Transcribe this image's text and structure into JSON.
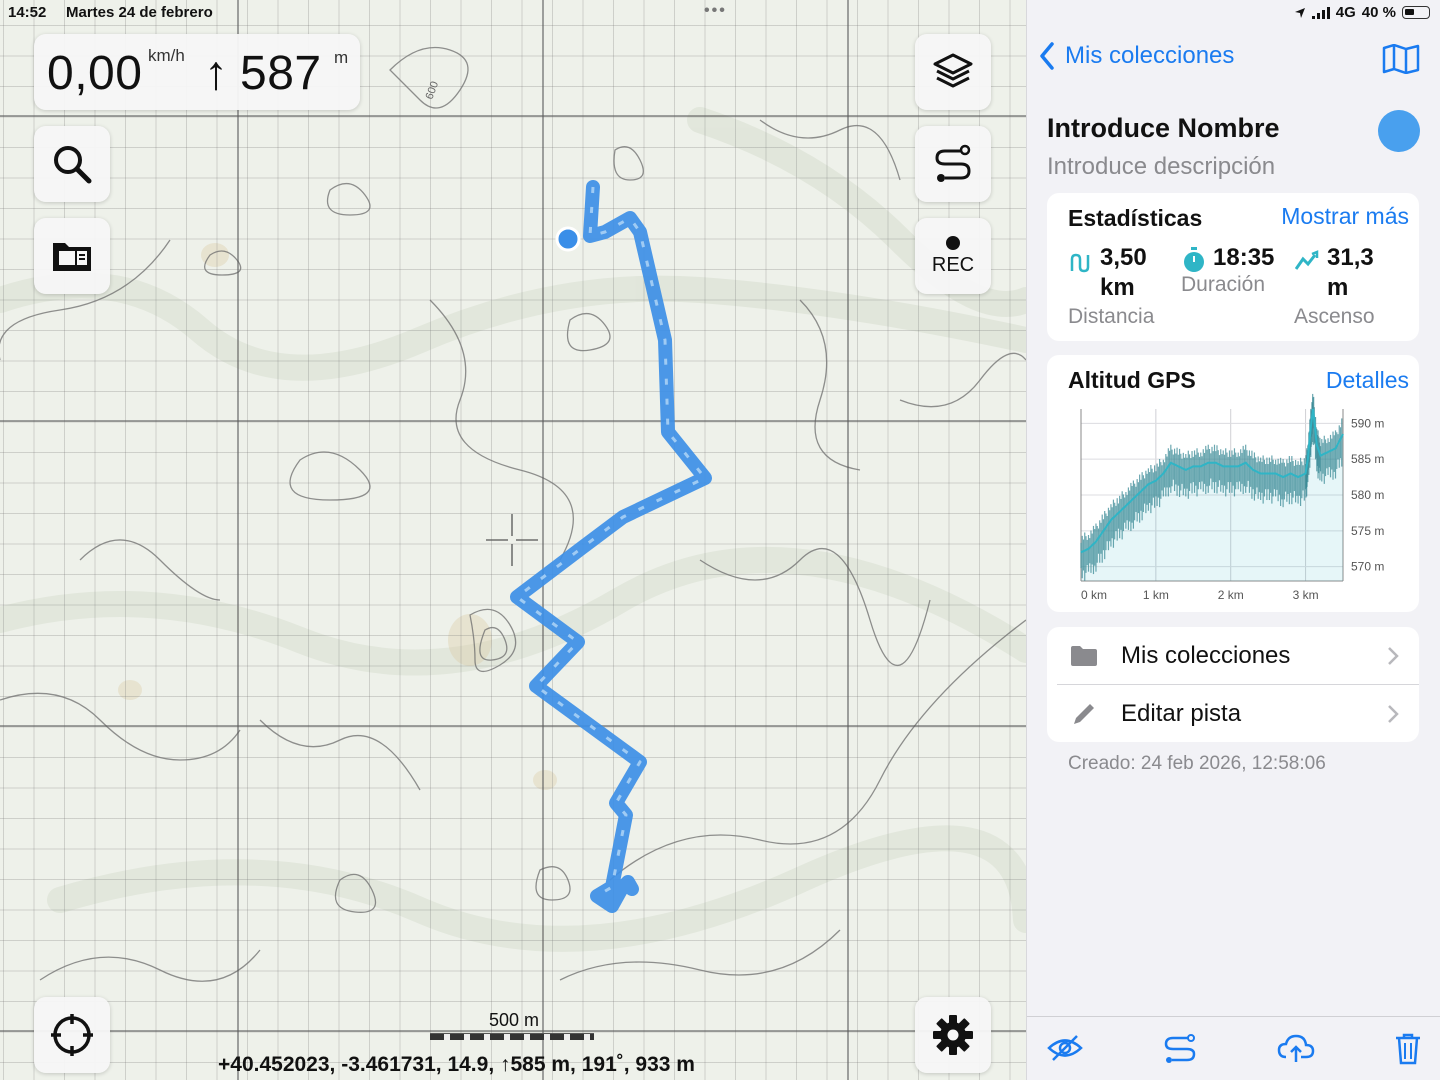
{
  "status": {
    "time": "14:52",
    "date": "Martes 24 de febrero",
    "network": "4G",
    "battery": "40 %"
  },
  "speed_panel": {
    "speed": "0,00",
    "speed_unit": "km/h",
    "altitude": "587",
    "altitude_unit": "m",
    "altitude_arrow": "↑"
  },
  "map_buttons": {
    "search": "search-icon",
    "collections": "folder-map-icon",
    "layers": "layers-icon",
    "route": "route-icon",
    "rec": "REC",
    "locate": "locate-icon",
    "settings": "gear-icon"
  },
  "map": {
    "contour_label": "600",
    "scale_label": "500 m",
    "coords": "+40.452023, -3.461731, 14.9, ↑585 m, 191˚, 933 m"
  },
  "panel": {
    "back_label": "Mis colecciones",
    "title": "Introduce Nombre",
    "description": "Introduce descripción",
    "track_color": "#49a0ee",
    "stats": {
      "heading": "Estadísticas",
      "more": "Mostrar más",
      "distance_value": "3,50",
      "distance_unit": "km",
      "distance_label": "Distancia",
      "duration_value": "18:35",
      "duration_label": "Duración",
      "ascent_value": "31,3",
      "ascent_unit": "m",
      "ascent_label": "Ascenso"
    },
    "altitude": {
      "heading": "Altitud GPS",
      "details": "Detalles"
    },
    "menu": [
      {
        "label": "Mis colecciones",
        "icon": "folder-icon"
      },
      {
        "label": "Editar pista",
        "icon": "pencil-icon"
      }
    ],
    "created": "Creado: 24 feb 2026, 12:58:06",
    "toolbar": [
      "hide-icon",
      "route-icon",
      "cloud-upload-icon",
      "trash-icon"
    ]
  },
  "chart_data": {
    "type": "line",
    "title": "Altitud GPS",
    "xlabel": "",
    "ylabel": "",
    "x_ticks": [
      "0 km",
      "1 km",
      "2 km",
      "3 km"
    ],
    "y_ticks": [
      "570 m",
      "575 m",
      "580 m",
      "585 m",
      "590 m"
    ],
    "xlim": [
      0,
      3.5
    ],
    "ylim": [
      568,
      592
    ],
    "grid": true,
    "series": [
      {
        "x": [
          0,
          0.1,
          0.2,
          0.3,
          0.4,
          0.5,
          0.6,
          0.7,
          0.8,
          0.9,
          1.0,
          1.1,
          1.2,
          1.3,
          1.4,
          1.5,
          1.6,
          1.7,
          1.8,
          1.9,
          2.0,
          2.1,
          2.2,
          2.3,
          2.4,
          2.5,
          2.6,
          2.7,
          2.8,
          2.9,
          3.0,
          3.03,
          3.07,
          3.1,
          3.15,
          3.2,
          3.3,
          3.4,
          3.5
        ],
        "y": [
          572,
          572.5,
          573.5,
          575,
          576.5,
          577.5,
          578.5,
          579.5,
          580.5,
          581.5,
          582,
          583,
          584.5,
          584,
          583.5,
          584,
          584,
          584.5,
          584.5,
          584,
          584,
          584,
          584.5,
          583.5,
          583,
          583,
          583,
          582.5,
          583,
          582.5,
          583,
          585,
          589.5,
          592,
          587,
          585.5,
          586,
          586.5,
          588.5
        ]
      }
    ]
  }
}
